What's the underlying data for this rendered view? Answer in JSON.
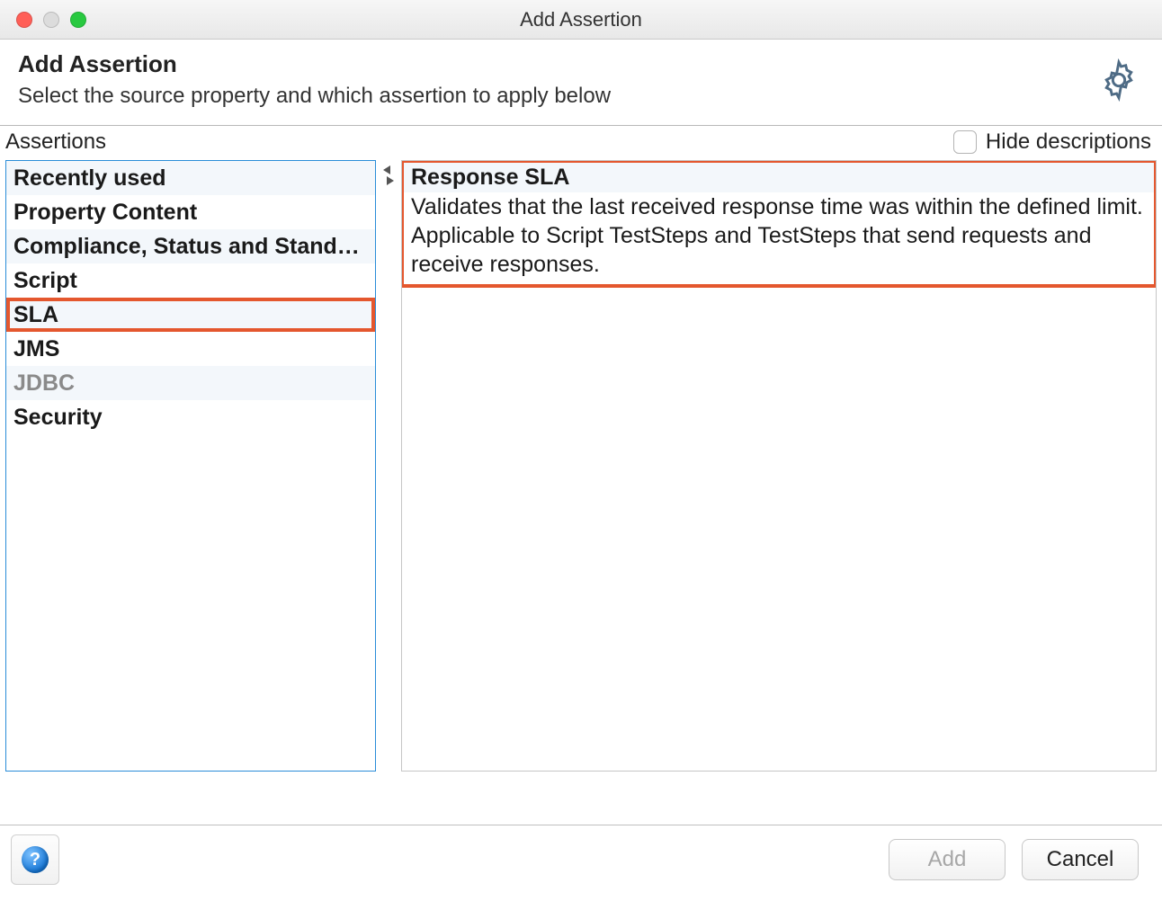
{
  "window": {
    "title": "Add Assertion"
  },
  "header": {
    "title": "Add Assertion",
    "subtitle": "Select the source property and which assertion to apply below"
  },
  "assertions_label": "Assertions",
  "hide_descriptions": {
    "label": "Hide descriptions",
    "checked": false
  },
  "categories": [
    {
      "label": "Recently used",
      "disabled": false
    },
    {
      "label": "Property Content",
      "disabled": false
    },
    {
      "label": "Compliance, Status and Stand…",
      "disabled": false
    },
    {
      "label": "Script",
      "disabled": false
    },
    {
      "label": "SLA",
      "disabled": false,
      "selected": true
    },
    {
      "label": "JMS",
      "disabled": false
    },
    {
      "label": "JDBC",
      "disabled": true
    },
    {
      "label": "Security",
      "disabled": false
    }
  ],
  "detail": {
    "title": "Response SLA",
    "description": "Validates that the last received response time was within the defined limit. Applicable to Script TestSteps and TestSteps that send requests and receive responses."
  },
  "footer": {
    "add": "Add",
    "cancel": "Cancel",
    "add_enabled": false
  }
}
